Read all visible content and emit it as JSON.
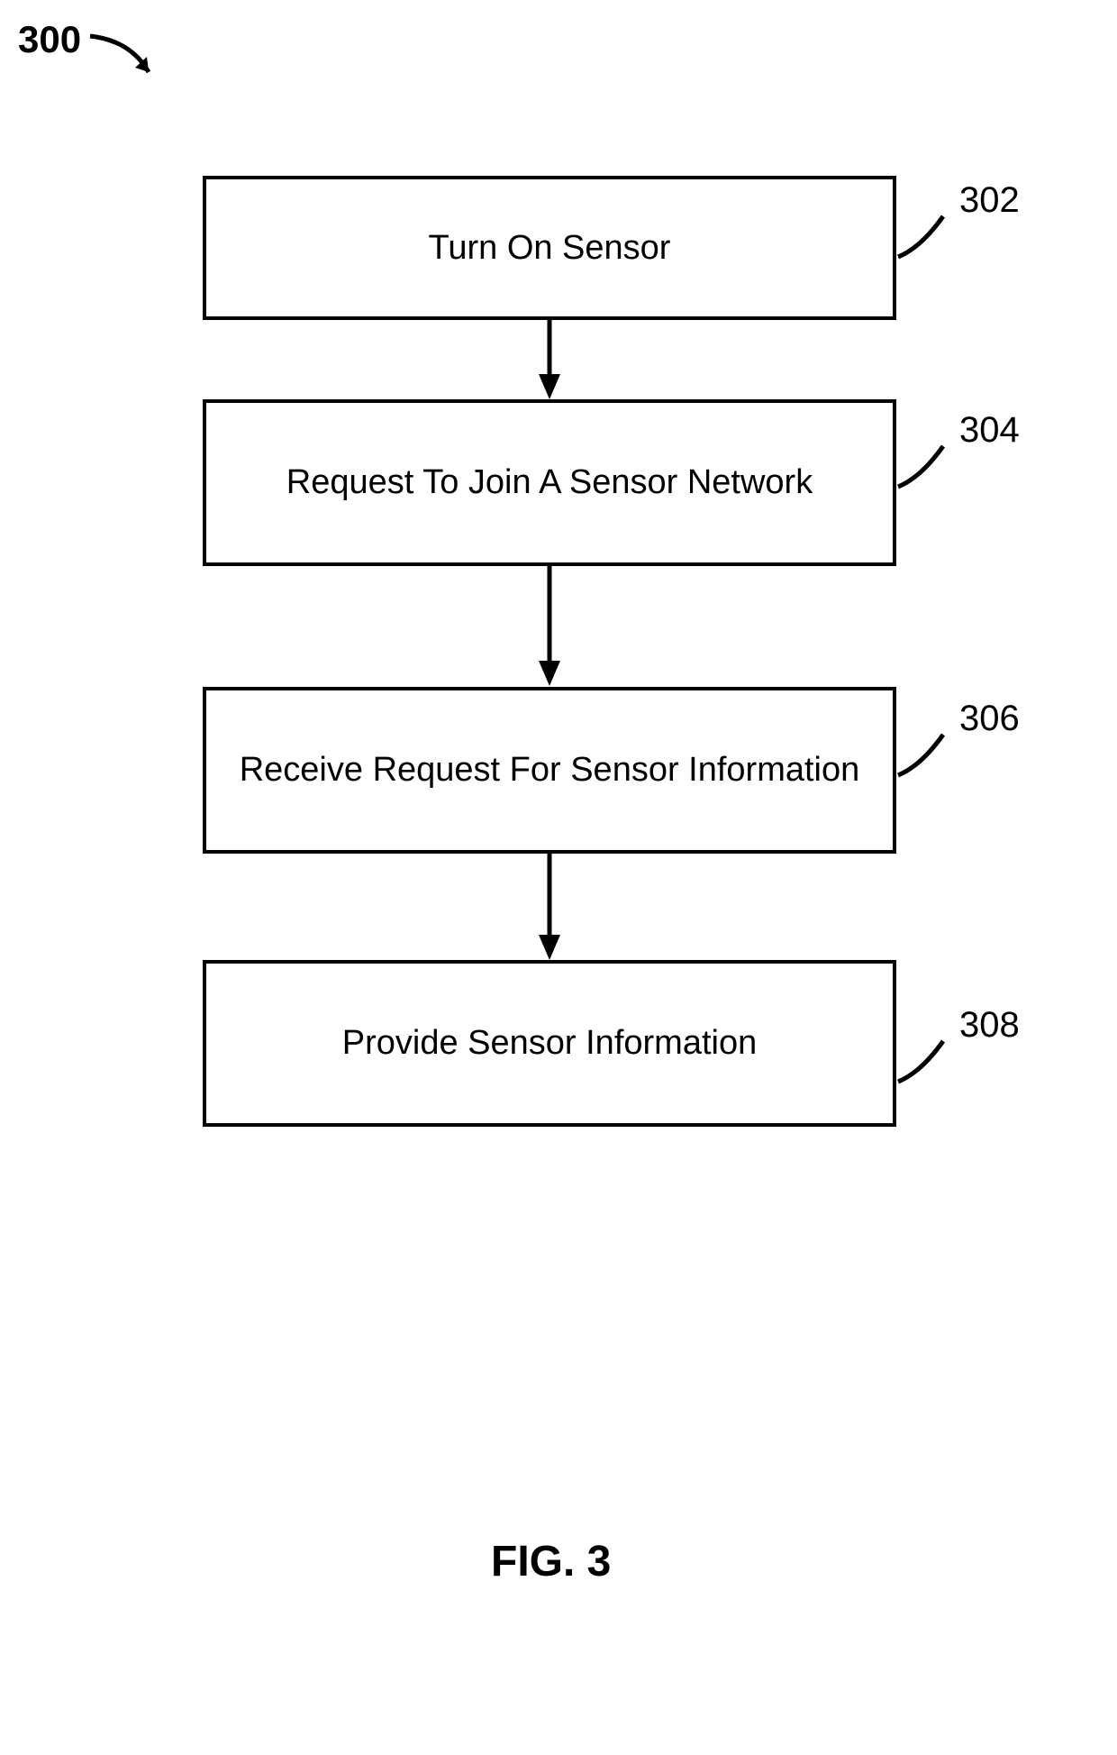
{
  "figure_number": "300",
  "caption": "FIG. 3",
  "steps": [
    {
      "label": "Turn On Sensor",
      "ref": "302"
    },
    {
      "label": "Request To Join A Sensor Network",
      "ref": "304"
    },
    {
      "label": "Receive Request For Sensor Information",
      "ref": "306"
    },
    {
      "label": "Provide Sensor Information",
      "ref": "308"
    }
  ]
}
